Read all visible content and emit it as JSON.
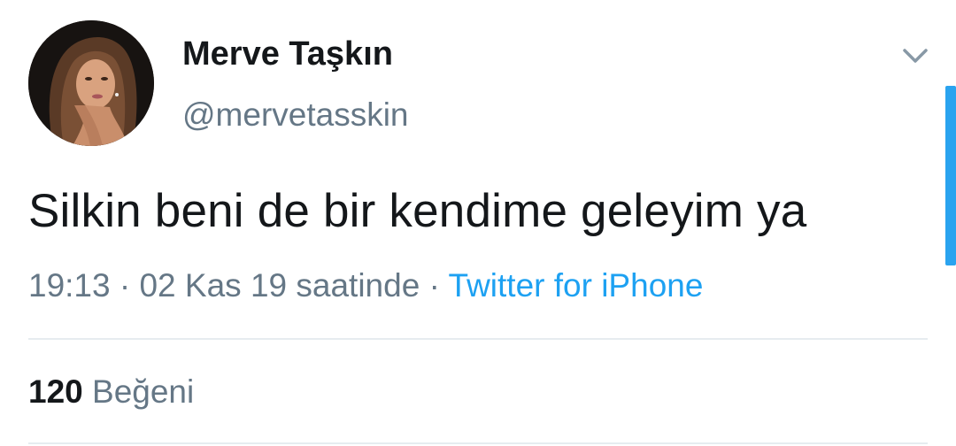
{
  "tweet": {
    "author": {
      "display_name": "Merve Taşkın",
      "handle": "@mervetasskin"
    },
    "text": "Silkin beni de bir kendime geleyim ya",
    "meta": {
      "time": "19:13",
      "separator": "·",
      "date": "02 Kas 19 saatinde",
      "source": "Twitter for iPhone"
    },
    "stats": {
      "likes_count": "120",
      "likes_label": "Beğeni"
    }
  },
  "icons": {
    "menu": "chevron-down-icon"
  },
  "colors": {
    "text_primary": "#14171a",
    "text_secondary": "#657786",
    "link": "#1da1f2",
    "divider": "#e6ecf0",
    "scrollbar": "#2aa3ef"
  }
}
